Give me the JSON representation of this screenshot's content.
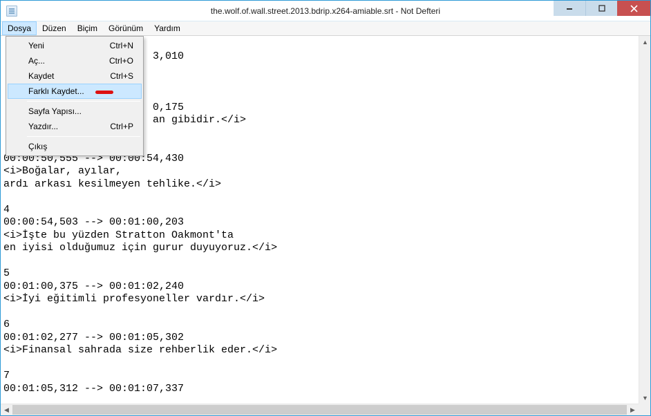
{
  "window": {
    "title": "the.wolf.of.wall.street.2013.bdrip.x264-amiable.srt - Not Defteri"
  },
  "menubar": {
    "items": [
      {
        "label": "Dosya"
      },
      {
        "label": "Düzen"
      },
      {
        "label": "Biçim"
      },
      {
        "label": "Görünüm"
      },
      {
        "label": "Yardım"
      }
    ]
  },
  "file_menu": {
    "items": [
      {
        "label": "Yeni",
        "shortcut": "Ctrl+N",
        "highlight": false
      },
      {
        "label": "Aç...",
        "shortcut": "Ctrl+O",
        "highlight": false
      },
      {
        "label": "Kaydet",
        "shortcut": "Ctrl+S",
        "highlight": false
      },
      {
        "label": "Farklı Kaydet...",
        "shortcut": "",
        "highlight": true
      },
      {
        "sep": true
      },
      {
        "label": "Sayfa Yapısı...",
        "shortcut": "",
        "highlight": false
      },
      {
        "label": "Yazdır...",
        "shortcut": "Ctrl+P",
        "highlight": false
      },
      {
        "sep": true
      },
      {
        "label": "Çıkış",
        "shortcut": "",
        "highlight": false
      }
    ]
  },
  "editor": {
    "text": "\n                        3,010\n\n\n\n                        0,175\n                        an gibidir.</i>\n\n\n00:00:50,555 --> 00:00:54,430\n<i>Boğalar, ayılar,\nardı arkası kesilmeyen tehlike.</i>\n\n4\n00:00:54,503 --> 00:01:00,203\n<i>İşte bu yüzden Stratton Oakmont'ta\nen iyisi olduğumuz için gurur duyuyoruz.</i>\n\n5\n00:01:00,375 --> 00:01:02,240\n<i>İyi eğitimli profesyoneller vardır.</i>\n\n6\n00:01:02,277 --> 00:01:05,302\n<i>Finansal sahrada size rehberlik eder.</i>\n\n7\n00:01:05,312 --> 00:01:07,337"
  }
}
